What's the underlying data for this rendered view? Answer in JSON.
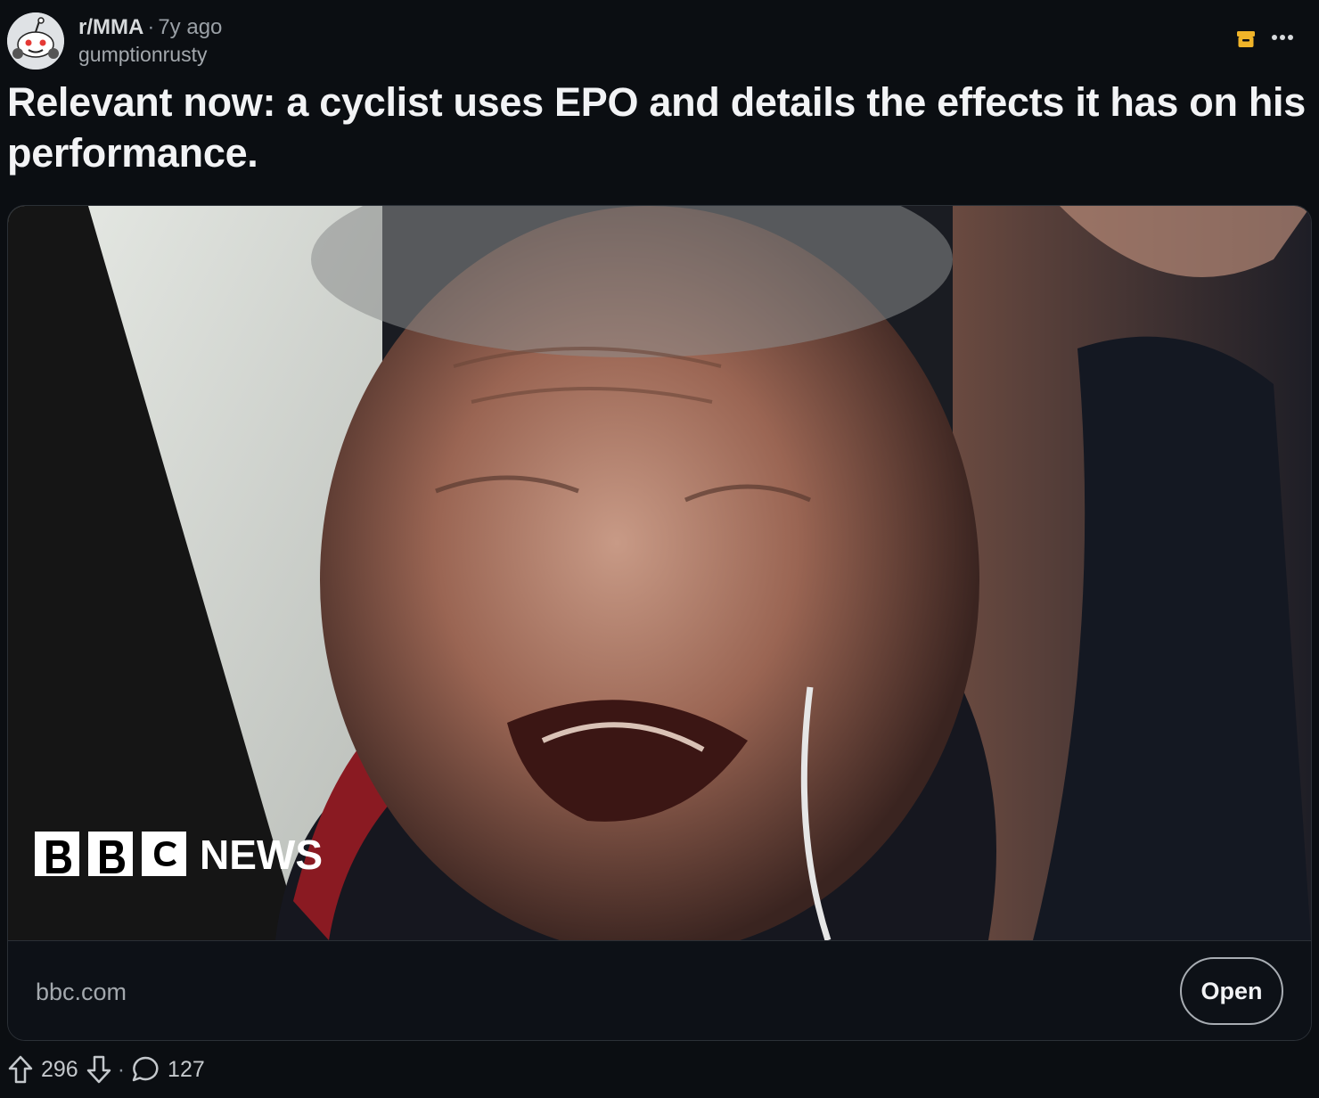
{
  "post": {
    "subreddit": "r/MMA",
    "separator": "·",
    "age": "7y ago",
    "author": "gumptionrusty",
    "title": "Relevant now: a cyclist uses EPO and details the effects it has on his performance."
  },
  "link_card": {
    "image_logo_text": "NEWS",
    "domain": "bbc.com",
    "open_label": "Open"
  },
  "actions": {
    "upvotes": "296",
    "separator": "·",
    "comments": "127"
  },
  "icons": {
    "avatar": "reddit-snoo-avatar",
    "archive": "archive-icon",
    "more": "more-options-icon",
    "upvote": "upvote-arrow-icon",
    "downvote": "downvote-arrow-icon",
    "comment": "comment-bubble-icon"
  },
  "colors": {
    "background": "#0b0e12",
    "accent_archive": "#f0b429",
    "text": "#d7dadc"
  }
}
